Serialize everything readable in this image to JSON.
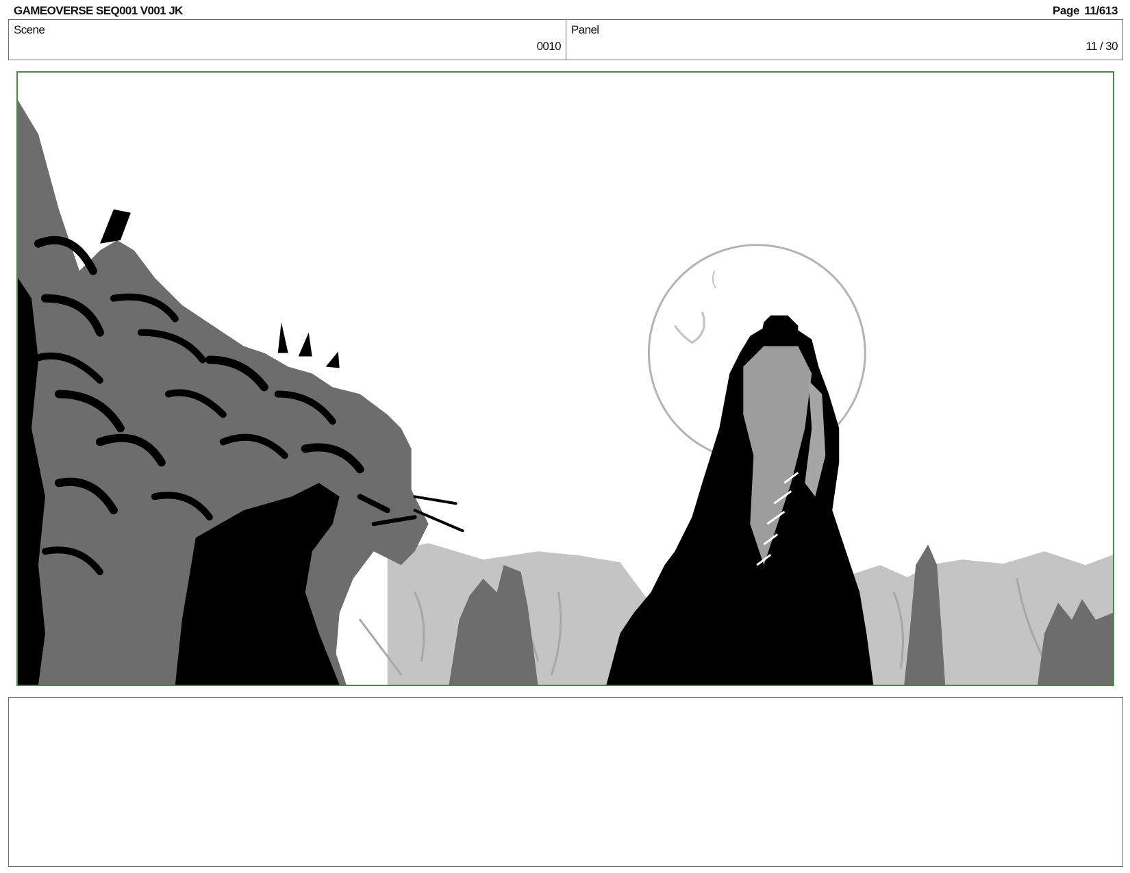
{
  "header": {
    "title": "GAMEOVERSE SEQ001 V001 JK",
    "page": "Page  11/613"
  },
  "info": {
    "scene_label": "Scene",
    "scene_value": "0010",
    "panel_label": "Panel",
    "panel_value": "11 / 30"
  },
  "colors": {
    "frame_border": "#3f8f3f",
    "ink_black": "#000000",
    "dark_gray": "#6d6d6d",
    "light_gray": "#c4c4c4",
    "moon_outline": "#b3b3b3"
  }
}
